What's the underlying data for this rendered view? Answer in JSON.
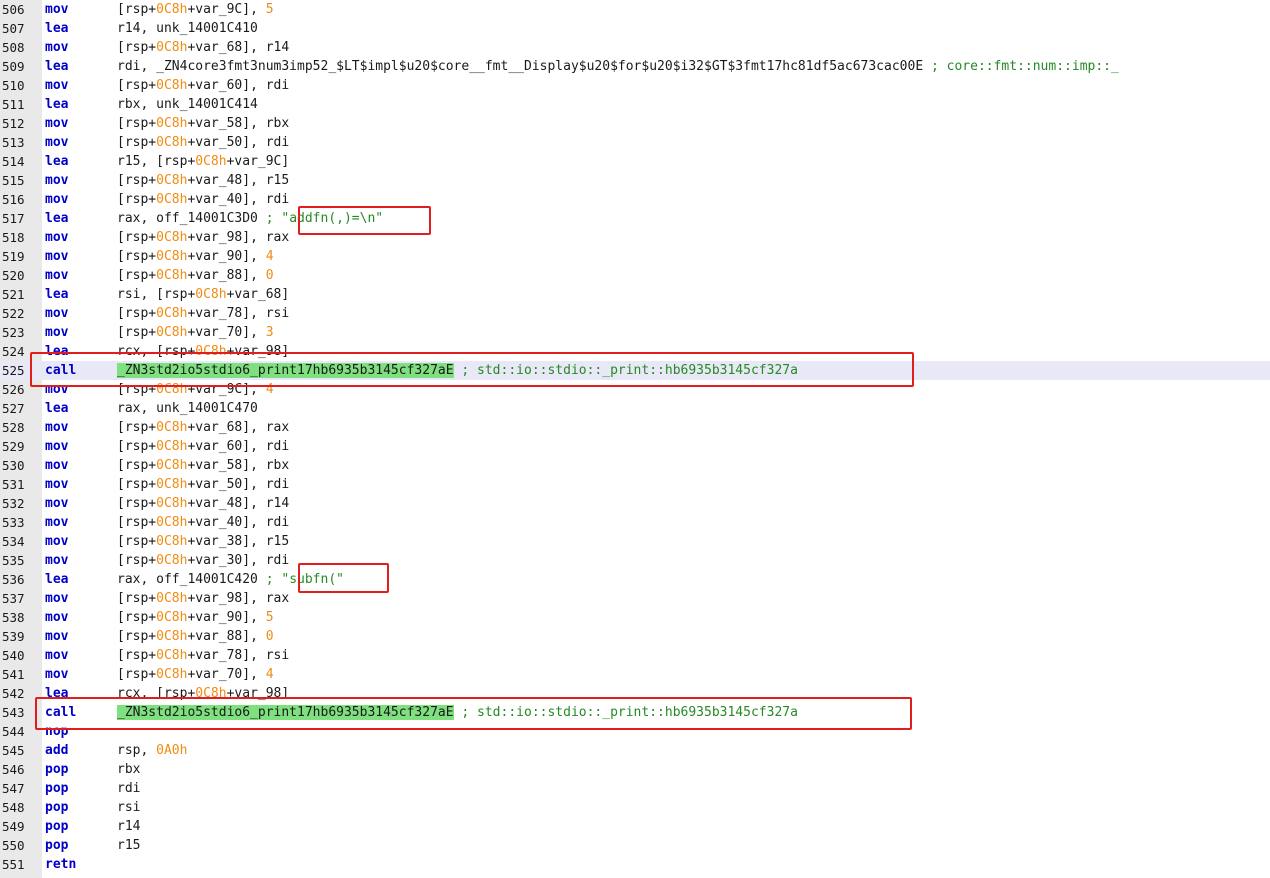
{
  "listing": {
    "rows": [
      {
        "ln": "506",
        "mn": "mov",
        "ops": [
          {
            "t": "[rsp+"
          },
          {
            "n": "0C8h"
          },
          {
            "t": "+var_9C], "
          },
          {
            "n": "5"
          }
        ]
      },
      {
        "ln": "507",
        "mn": "lea",
        "ops": [
          {
            "t": "r14, unk_14001C410"
          }
        ]
      },
      {
        "ln": "508",
        "mn": "mov",
        "ops": [
          {
            "t": "[rsp+"
          },
          {
            "n": "0C8h"
          },
          {
            "t": "+var_68], r14"
          }
        ]
      },
      {
        "ln": "509",
        "mn": "lea",
        "ops": [
          {
            "t": "rdi, _ZN4core3fmt3num3imp52_$LT$impl$u20$core__fmt__Display$u20$for$u20$i32$GT$3fmt17hc81df5ac673cac00E "
          },
          {
            "c": "; core::fmt::num::imp::_"
          }
        ]
      },
      {
        "ln": "510",
        "mn": "mov",
        "ops": [
          {
            "t": "[rsp+"
          },
          {
            "n": "0C8h"
          },
          {
            "t": "+var_60], rdi"
          }
        ]
      },
      {
        "ln": "511",
        "mn": "lea",
        "ops": [
          {
            "t": "rbx, unk_14001C414"
          }
        ]
      },
      {
        "ln": "512",
        "mn": "mov",
        "ops": [
          {
            "t": "[rsp+"
          },
          {
            "n": "0C8h"
          },
          {
            "t": "+var_58], rbx"
          }
        ]
      },
      {
        "ln": "513",
        "mn": "mov",
        "ops": [
          {
            "t": "[rsp+"
          },
          {
            "n": "0C8h"
          },
          {
            "t": "+var_50], rdi"
          }
        ]
      },
      {
        "ln": "514",
        "mn": "lea",
        "ops": [
          {
            "t": "r15, [rsp+"
          },
          {
            "n": "0C8h"
          },
          {
            "t": "+var_9C]"
          }
        ]
      },
      {
        "ln": "515",
        "mn": "mov",
        "ops": [
          {
            "t": "[rsp+"
          },
          {
            "n": "0C8h"
          },
          {
            "t": "+var_48], r15"
          }
        ]
      },
      {
        "ln": "516",
        "mn": "mov",
        "ops": [
          {
            "t": "[rsp+"
          },
          {
            "n": "0C8h"
          },
          {
            "t": "+var_40], rdi"
          }
        ]
      },
      {
        "ln": "517",
        "mn": "lea",
        "ops": [
          {
            "t": "rax, off_14001C3D0 "
          },
          {
            "c": "; \"addfn(,)=\\n\""
          }
        ]
      },
      {
        "ln": "518",
        "mn": "mov",
        "ops": [
          {
            "t": "[rsp+"
          },
          {
            "n": "0C8h"
          },
          {
            "t": "+var_98], rax"
          }
        ]
      },
      {
        "ln": "519",
        "mn": "mov",
        "ops": [
          {
            "t": "[rsp+"
          },
          {
            "n": "0C8h"
          },
          {
            "t": "+var_90], "
          },
          {
            "n": "4"
          }
        ]
      },
      {
        "ln": "520",
        "mn": "mov",
        "ops": [
          {
            "t": "[rsp+"
          },
          {
            "n": "0C8h"
          },
          {
            "t": "+var_88], "
          },
          {
            "n": "0"
          }
        ]
      },
      {
        "ln": "521",
        "mn": "lea",
        "ops": [
          {
            "t": "rsi, [rsp+"
          },
          {
            "n": "0C8h"
          },
          {
            "t": "+var_68]"
          }
        ]
      },
      {
        "ln": "522",
        "mn": "mov",
        "ops": [
          {
            "t": "[rsp+"
          },
          {
            "n": "0C8h"
          },
          {
            "t": "+var_78], rsi"
          }
        ]
      },
      {
        "ln": "523",
        "mn": "mov",
        "ops": [
          {
            "t": "[rsp+"
          },
          {
            "n": "0C8h"
          },
          {
            "t": "+var_70], "
          },
          {
            "n": "3"
          }
        ]
      },
      {
        "ln": "524",
        "mn": "lea",
        "ops": [
          {
            "t": "rcx, [rsp+"
          },
          {
            "n": "0C8h"
          },
          {
            "t": "+var_98]"
          }
        ]
      },
      {
        "ln": "525",
        "mn": "call",
        "hl": true,
        "ops": [
          {
            "h": "_ZN3std2io5stdio6_print17hb6935b3145cf327aE"
          },
          {
            "c": " ; std::io::stdio::_print::hb6935b3145cf327a"
          }
        ]
      },
      {
        "ln": "526",
        "mn": "mov",
        "ops": [
          {
            "t": "[rsp+"
          },
          {
            "n": "0C8h"
          },
          {
            "t": "+var_9C], "
          },
          {
            "n": "4"
          }
        ]
      },
      {
        "ln": "527",
        "mn": "lea",
        "ops": [
          {
            "t": "rax, unk_14001C470"
          }
        ]
      },
      {
        "ln": "528",
        "mn": "mov",
        "ops": [
          {
            "t": "[rsp+"
          },
          {
            "n": "0C8h"
          },
          {
            "t": "+var_68], rax"
          }
        ]
      },
      {
        "ln": "529",
        "mn": "mov",
        "ops": [
          {
            "t": "[rsp+"
          },
          {
            "n": "0C8h"
          },
          {
            "t": "+var_60], rdi"
          }
        ]
      },
      {
        "ln": "530",
        "mn": "mov",
        "ops": [
          {
            "t": "[rsp+"
          },
          {
            "n": "0C8h"
          },
          {
            "t": "+var_58], rbx"
          }
        ]
      },
      {
        "ln": "531",
        "mn": "mov",
        "ops": [
          {
            "t": "[rsp+"
          },
          {
            "n": "0C8h"
          },
          {
            "t": "+var_50], rdi"
          }
        ]
      },
      {
        "ln": "532",
        "mn": "mov",
        "ops": [
          {
            "t": "[rsp+"
          },
          {
            "n": "0C8h"
          },
          {
            "t": "+var_48], r14"
          }
        ]
      },
      {
        "ln": "533",
        "mn": "mov",
        "ops": [
          {
            "t": "[rsp+"
          },
          {
            "n": "0C8h"
          },
          {
            "t": "+var_40], rdi"
          }
        ]
      },
      {
        "ln": "534",
        "mn": "mov",
        "ops": [
          {
            "t": "[rsp+"
          },
          {
            "n": "0C8h"
          },
          {
            "t": "+var_38], r15"
          }
        ]
      },
      {
        "ln": "535",
        "mn": "mov",
        "ops": [
          {
            "t": "[rsp+"
          },
          {
            "n": "0C8h"
          },
          {
            "t": "+var_30], rdi"
          }
        ]
      },
      {
        "ln": "536",
        "mn": "lea",
        "ops": [
          {
            "t": "rax, off_14001C420 "
          },
          {
            "c": "; \"subfn(\""
          }
        ]
      },
      {
        "ln": "537",
        "mn": "mov",
        "ops": [
          {
            "t": "[rsp+"
          },
          {
            "n": "0C8h"
          },
          {
            "t": "+var_98], rax"
          }
        ]
      },
      {
        "ln": "538",
        "mn": "mov",
        "ops": [
          {
            "t": "[rsp+"
          },
          {
            "n": "0C8h"
          },
          {
            "t": "+var_90], "
          },
          {
            "n": "5"
          }
        ]
      },
      {
        "ln": "539",
        "mn": "mov",
        "ops": [
          {
            "t": "[rsp+"
          },
          {
            "n": "0C8h"
          },
          {
            "t": "+var_88], "
          },
          {
            "n": "0"
          }
        ]
      },
      {
        "ln": "540",
        "mn": "mov",
        "ops": [
          {
            "t": "[rsp+"
          },
          {
            "n": "0C8h"
          },
          {
            "t": "+var_78], rsi"
          }
        ]
      },
      {
        "ln": "541",
        "mn": "mov",
        "ops": [
          {
            "t": "[rsp+"
          },
          {
            "n": "0C8h"
          },
          {
            "t": "+var_70], "
          },
          {
            "n": "4"
          }
        ]
      },
      {
        "ln": "542",
        "mn": "lea",
        "ops": [
          {
            "t": "rcx, [rsp+"
          },
          {
            "n": "0C8h"
          },
          {
            "t": "+var_98]"
          }
        ]
      },
      {
        "ln": "543",
        "mn": "call",
        "ops": [
          {
            "h": "_ZN3std2io5stdio6_print17hb6935b3145cf327aE"
          },
          {
            "c": " ; std::io::stdio::_print::hb6935b3145cf327a"
          }
        ]
      },
      {
        "ln": "544",
        "mn": "nop",
        "ops": []
      },
      {
        "ln": "545",
        "mn": "add",
        "ops": [
          {
            "t": "rsp, "
          },
          {
            "n": "0A0h"
          }
        ]
      },
      {
        "ln": "546",
        "mn": "pop",
        "ops": [
          {
            "t": "rbx"
          }
        ]
      },
      {
        "ln": "547",
        "mn": "pop",
        "ops": [
          {
            "t": "rdi"
          }
        ]
      },
      {
        "ln": "548",
        "mn": "pop",
        "ops": [
          {
            "t": "rsi"
          }
        ]
      },
      {
        "ln": "549",
        "mn": "pop",
        "ops": [
          {
            "t": "r14"
          }
        ]
      },
      {
        "ln": "550",
        "mn": "pop",
        "ops": [
          {
            "t": "r15"
          }
        ]
      },
      {
        "ln": "551",
        "mn": "retn",
        "ops": []
      }
    ]
  },
  "colors": {
    "mnemonic": "#0000c8",
    "number": "#f08c14",
    "comment": "#258a25",
    "symbol_highlight": "#7ee07e",
    "annotation_box": "#e01e1e"
  }
}
